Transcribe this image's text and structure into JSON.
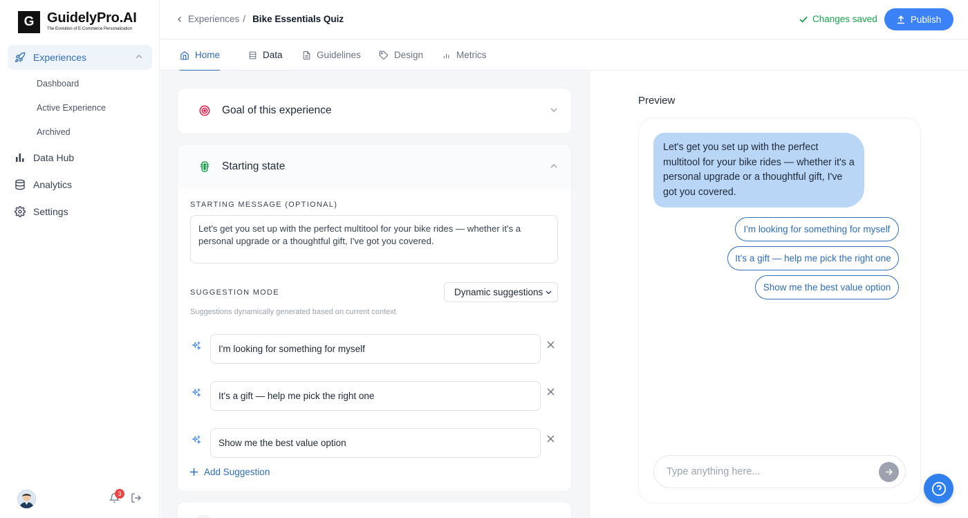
{
  "brand": {
    "mark": "G",
    "name": "GuidelyPro.AI",
    "tagline": "The Evolution of E-Commerce Personalization"
  },
  "sidebar": {
    "items": [
      {
        "label": "Experiences",
        "icon": "rocket-icon",
        "active": true
      },
      {
        "label": "Data Hub",
        "icon": "bar-chart-icon"
      },
      {
        "label": "Analytics",
        "icon": "database-icon"
      },
      {
        "label": "Settings",
        "icon": "gear-icon"
      }
    ],
    "sub_items": [
      "Dashboard",
      "Active Experience",
      "Archived"
    ],
    "notification_count": "3"
  },
  "header": {
    "breadcrumb_parent": "Experiences",
    "breadcrumb_separator": "/",
    "breadcrumb_current": "Bike Essentials Quiz",
    "status": "Changes saved",
    "publish_label": "Publish"
  },
  "tabs": [
    {
      "label": "Home",
      "icon": "home-icon",
      "active": true
    },
    {
      "label": "Data",
      "icon": "document-icon"
    },
    {
      "label": "Guidelines",
      "icon": "file-icon"
    },
    {
      "label": "Design",
      "icon": "tag-icon"
    },
    {
      "label": "Metrics",
      "icon": "bar-chart-icon"
    }
  ],
  "goal_card": {
    "title": "Goal of this experience"
  },
  "starting_state": {
    "title": "Starting state",
    "message_label": "STARTING MESSAGE (OPTIONAL)",
    "message": "Let's get you set up with the perfect multitool for your bike rides — whether it's a personal upgrade or a thoughtful gift, I've got you covered.",
    "suggestion_mode_label": "SUGGESTION MODE",
    "suggestion_mode_value": "Dynamic suggestions",
    "helper_text": "Suggestions dynamically generated based on current context",
    "suggestions": [
      "I'm looking for something for myself",
      "It's a gift — help me pick the right one",
      "Show me the best value option"
    ],
    "add_label": "Add Suggestion"
  },
  "preview": {
    "title": "Preview",
    "bot_message": "Let's get you set up with the perfect multitool for your bike rides — whether it's a personal upgrade or a thoughtful gift, I've got you covered.",
    "chips": [
      "I'm looking for something for myself",
      "It's a gift — help me pick the right one",
      "Show me the best value option"
    ],
    "input_placeholder": "Type anything here..."
  },
  "colors": {
    "accent": "#2f6eba",
    "publish": "#3b82f6",
    "saved": "#16a34a",
    "bubble": "#b9d6f7",
    "goal_icon": "#e11d48",
    "state_icon": "#16a34a"
  }
}
